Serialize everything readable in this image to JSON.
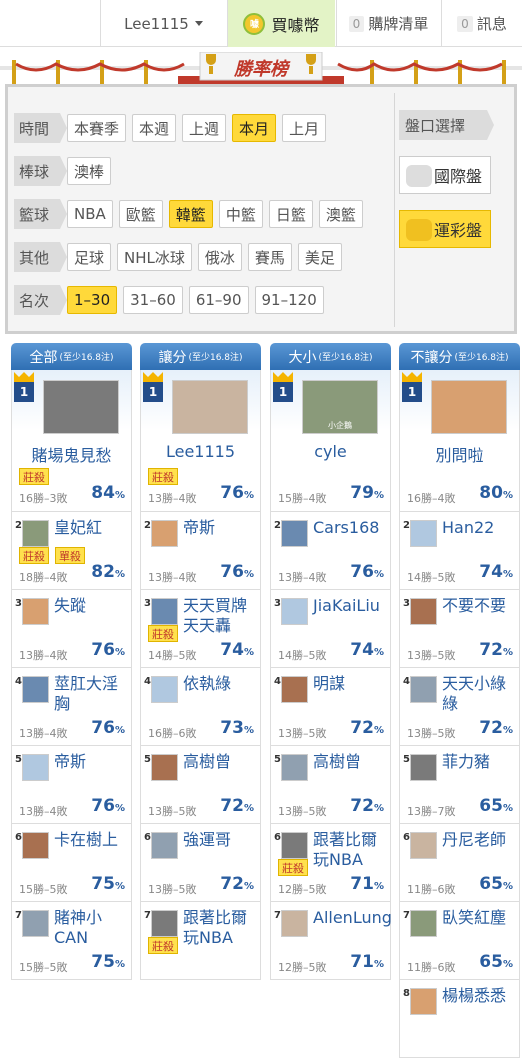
{
  "topbar": {
    "user": "Lee1115",
    "buy": "買噱幣",
    "coin": "噱",
    "cart_count": "0",
    "cart": "購牌清單",
    "msg_count": "0",
    "msg": "訊息"
  },
  "banner": {
    "title": "勝率榜"
  },
  "filters": {
    "time": {
      "label": "時間",
      "options": [
        "本賽季",
        "本週",
        "上週",
        "本月",
        "上月"
      ],
      "selected": "本月"
    },
    "baseball": {
      "label": "棒球",
      "options": [
        "澳棒"
      ]
    },
    "basketball": {
      "label": "籃球",
      "options": [
        "NBA",
        "歐籃",
        "韓籃",
        "中籃",
        "日籃",
        "澳籃"
      ],
      "selected": "韓籃"
    },
    "other": {
      "label": "其他",
      "options": [
        "足球",
        "NHL冰球",
        "俄冰",
        "賽馬",
        "美足"
      ]
    },
    "rank": {
      "label": "名次",
      "options": [
        "1–30",
        "31–60",
        "61–90",
        "91–120"
      ],
      "selected": "1–30"
    }
  },
  "panel": {
    "label": "盤口選擇",
    "intl": "國際盤",
    "lottery": "運彩盤",
    "selected": "運彩盤"
  },
  "colors": {
    "accent": "#2a5d9f",
    "highlight": "#ffd93a"
  },
  "columns": [
    {
      "title": "全部",
      "note": "(至少16.8注)",
      "top": {
        "name": "賭場鬼見愁",
        "tags": [
          "莊殺"
        ],
        "record": "16勝–3敗",
        "pct": "84"
      },
      "rows": [
        {
          "rank": "2",
          "name": "皇妃紅",
          "tags": [
            "莊殺",
            "單殺"
          ],
          "record": "18勝–4敗",
          "pct": "82"
        },
        {
          "rank": "3",
          "name": "失蹤",
          "tags": [],
          "record": "13勝–4敗",
          "pct": "76"
        },
        {
          "rank": "4",
          "name": "莖肛大淫胸",
          "tags": [],
          "record": "13勝–4敗",
          "pct": "76"
        },
        {
          "rank": "5",
          "name": "帝斯",
          "tags": [],
          "record": "13勝–4敗",
          "pct": "76"
        },
        {
          "rank": "6",
          "name": "卡在樹上",
          "tags": [],
          "record": "15勝–5敗",
          "pct": "75"
        },
        {
          "rank": "7",
          "name": "賭神小CAN",
          "tags": [],
          "record": "15勝–5敗",
          "pct": "75"
        }
      ]
    },
    {
      "title": "讓分",
      "note": "(至少16.8注)",
      "top": {
        "name": "Lee1115",
        "tags": [
          "莊殺"
        ],
        "record": "13勝–4敗",
        "pct": "76"
      },
      "rows": [
        {
          "rank": "2",
          "name": "帝斯",
          "tags": [],
          "record": "13勝–4敗",
          "pct": "76"
        },
        {
          "rank": "3",
          "name": "天天買牌天天轟",
          "tags": [
            "莊殺"
          ],
          "record": "14勝–5敗",
          "pct": "74"
        },
        {
          "rank": "4",
          "name": "依執綠",
          "tags": [],
          "record": "16勝–6敗",
          "pct": "73"
        },
        {
          "rank": "5",
          "name": "高樹曾",
          "tags": [],
          "record": "13勝–5敗",
          "pct": "72"
        },
        {
          "rank": "6",
          "name": "強運哥",
          "tags": [],
          "record": "13勝–5敗",
          "pct": "72"
        },
        {
          "rank": "7",
          "name": "跟著比爾玩NBA",
          "tags": [
            "莊殺"
          ],
          "record": "",
          "pct": ""
        }
      ]
    },
    {
      "title": "大小",
      "note": "(至少16.8注)",
      "top": {
        "name": "cyle",
        "avatar_text": "小企鵝",
        "tags": [],
        "record": "15勝–4敗",
        "pct": "79"
      },
      "rows": [
        {
          "rank": "2",
          "name": "Cars168",
          "tags": [],
          "record": "13勝–4敗",
          "pct": "76"
        },
        {
          "rank": "3",
          "name": "JiaKaiLiu",
          "tags": [],
          "record": "14勝–5敗",
          "pct": "74"
        },
        {
          "rank": "4",
          "name": "明謀",
          "tags": [],
          "record": "13勝–5敗",
          "pct": "72"
        },
        {
          "rank": "5",
          "name": "高樹曾",
          "tags": [],
          "record": "13勝–5敗",
          "pct": "72"
        },
        {
          "rank": "6",
          "name": "跟著比爾玩NBA",
          "tags": [
            "莊殺"
          ],
          "record": "12勝–5敗",
          "pct": "71"
        },
        {
          "rank": "7",
          "name": "AllenLung",
          "tags": [],
          "record": "12勝–5敗",
          "pct": "71"
        }
      ]
    },
    {
      "title": "不讓分",
      "note": "(至少16.8注)",
      "top": {
        "name": "別問啦",
        "tags": [],
        "record": "16勝–4敗",
        "pct": "80"
      },
      "rows": [
        {
          "rank": "2",
          "name": "Han22",
          "tags": [],
          "record": "14勝–5敗",
          "pct": "74"
        },
        {
          "rank": "3",
          "name": "不要不要",
          "tags": [],
          "record": "13勝–5敗",
          "pct": "72"
        },
        {
          "rank": "4",
          "name": "天天小綠綠",
          "tags": [],
          "record": "13勝–5敗",
          "pct": "72"
        },
        {
          "rank": "5",
          "name": "菲力豬",
          "tags": [],
          "record": "13勝–7敗",
          "pct": "65"
        },
        {
          "rank": "6",
          "name": "丹尼老師",
          "tags": [],
          "record": "11勝–6敗",
          "pct": "65"
        },
        {
          "rank": "7",
          "name": "臥笑紅塵",
          "tags": [],
          "record": "11勝–6敗",
          "pct": "65"
        },
        {
          "rank": "8",
          "name": "楊楊悉悉",
          "tags": [],
          "record": "",
          "pct": ""
        }
      ]
    }
  ]
}
